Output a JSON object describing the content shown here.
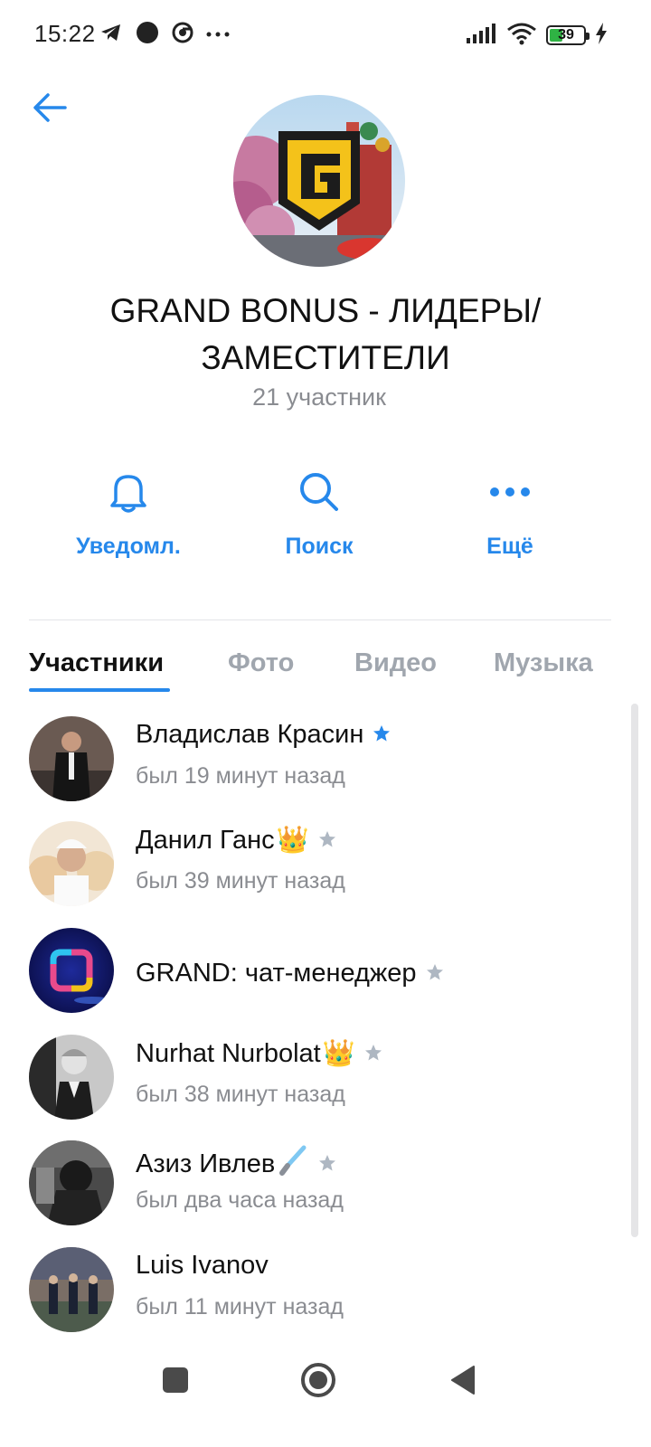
{
  "status_bar": {
    "time": "15:22",
    "battery": "39",
    "battery_level": 0.39,
    "icons_left": [
      "telegram-icon",
      "dot-icon",
      "chrome-icon",
      "more-icon"
    ],
    "icons_right": [
      "signal-icon",
      "wifi-icon",
      "battery-icon",
      "charging-icon"
    ]
  },
  "header": {
    "title": "GRAND BONUS - ЛИДЕРЫ/ ЗАМЕСТИТЕЛИ",
    "members_count": "21 участник",
    "avatar_icon": "grand-logo-avatar"
  },
  "actions": [
    {
      "label": "Уведомл.",
      "icon": "bell-icon"
    },
    {
      "label": "Поиск",
      "icon": "search-icon"
    },
    {
      "label": "Ещё",
      "icon": "more-dots-icon"
    }
  ],
  "tabs": [
    {
      "label": "Участники",
      "active": true
    },
    {
      "label": "Фото",
      "active": false
    },
    {
      "label": "Видео",
      "active": false
    },
    {
      "label": "Музыка",
      "active": false
    }
  ],
  "members": [
    {
      "name": "Владислав Красин",
      "emoji": "",
      "status": "был 19 минут назад",
      "star": "blue"
    },
    {
      "name": "Данил Ганс",
      "emoji": "👑",
      "status": "был 39 минут назад",
      "star": "gray"
    },
    {
      "name": "GRAND: чат-менеджер",
      "emoji": "",
      "status": "",
      "star": "gray"
    },
    {
      "name": "Nurhat Nurbolat",
      "emoji": "👑",
      "status": "был 38 минут назад",
      "star": "gray"
    },
    {
      "name": "Азиз Ивлев",
      "emoji": "🗡",
      "status": "был два часа назад",
      "star": "gray"
    },
    {
      "name": "Luis Ivanov",
      "emoji": "",
      "status": "был 11 минут назад",
      "star": ""
    }
  ],
  "colors": {
    "accent": "#2688eb",
    "secondary_text": "#8a8c91",
    "star_admin": "#2688eb",
    "star_moderator": "#aeb7c2"
  }
}
